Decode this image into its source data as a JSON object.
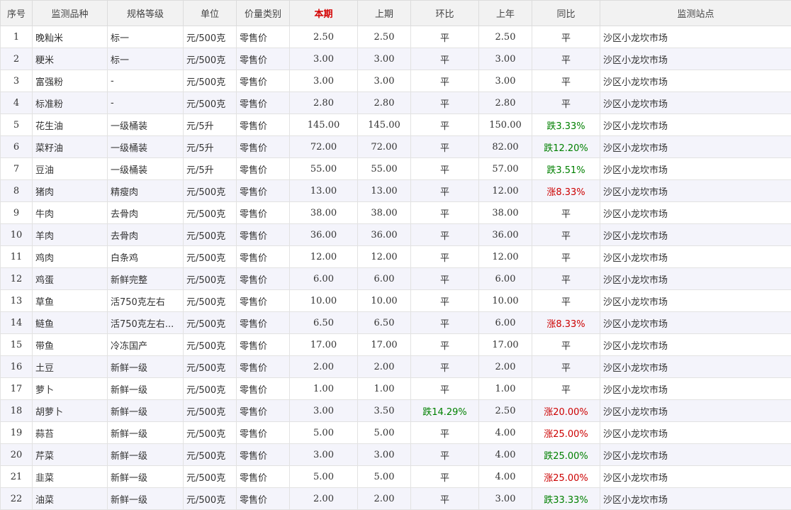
{
  "colors": {
    "current_header": "#d40000",
    "rise": "#cc0000",
    "fall": "#008000",
    "header_bg": "#f2f2f2",
    "stripe_bg": "#f4f4fb"
  },
  "headers": {
    "index": "序号",
    "name": "监测品种",
    "spec": "规格等级",
    "unit": "单位",
    "price_type": "价量类别",
    "current": "本期",
    "previous": "上期",
    "mom": "环比",
    "last_year": "上年",
    "yoy": "同比",
    "site": "监测站点"
  },
  "rows": [
    {
      "index": "1",
      "name": "晚籼米",
      "spec": "标一",
      "unit": "元/500克",
      "price_type": "零售价",
      "current": "2.50",
      "previous": "2.50",
      "mom": "平",
      "mom_dir": "flat",
      "last_year": "2.50",
      "yoy": "平",
      "yoy_dir": "flat",
      "site": "沙区小龙坎市场"
    },
    {
      "index": "2",
      "name": "粳米",
      "spec": "标一",
      "unit": "元/500克",
      "price_type": "零售价",
      "current": "3.00",
      "previous": "3.00",
      "mom": "平",
      "mom_dir": "flat",
      "last_year": "3.00",
      "yoy": "平",
      "yoy_dir": "flat",
      "site": "沙区小龙坎市场"
    },
    {
      "index": "3",
      "name": "富强粉",
      "spec": "-",
      "unit": "元/500克",
      "price_type": "零售价",
      "current": "3.00",
      "previous": "3.00",
      "mom": "平",
      "mom_dir": "flat",
      "last_year": "3.00",
      "yoy": "平",
      "yoy_dir": "flat",
      "site": "沙区小龙坎市场"
    },
    {
      "index": "4",
      "name": "标准粉",
      "spec": "-",
      "unit": "元/500克",
      "price_type": "零售价",
      "current": "2.80",
      "previous": "2.80",
      "mom": "平",
      "mom_dir": "flat",
      "last_year": "2.80",
      "yoy": "平",
      "yoy_dir": "flat",
      "site": "沙区小龙坎市场"
    },
    {
      "index": "5",
      "name": "花生油",
      "spec": "一级桶装",
      "unit": "元/5升",
      "price_type": "零售价",
      "current": "145.00",
      "previous": "145.00",
      "mom": "平",
      "mom_dir": "flat",
      "last_year": "150.00",
      "yoy": "跌3.33%",
      "yoy_dir": "down",
      "site": "沙区小龙坎市场"
    },
    {
      "index": "6",
      "name": "菜籽油",
      "spec": "一级桶装",
      "unit": "元/5升",
      "price_type": "零售价",
      "current": "72.00",
      "previous": "72.00",
      "mom": "平",
      "mom_dir": "flat",
      "last_year": "82.00",
      "yoy": "跌12.20%",
      "yoy_dir": "down",
      "site": "沙区小龙坎市场"
    },
    {
      "index": "7",
      "name": "豆油",
      "spec": "一级桶装",
      "unit": "元/5升",
      "price_type": "零售价",
      "current": "55.00",
      "previous": "55.00",
      "mom": "平",
      "mom_dir": "flat",
      "last_year": "57.00",
      "yoy": "跌3.51%",
      "yoy_dir": "down",
      "site": "沙区小龙坎市场"
    },
    {
      "index": "8",
      "name": "猪肉",
      "spec": "精瘦肉",
      "unit": "元/500克",
      "price_type": "零售价",
      "current": "13.00",
      "previous": "13.00",
      "mom": "平",
      "mom_dir": "flat",
      "last_year": "12.00",
      "yoy": "涨8.33%",
      "yoy_dir": "up",
      "site": "沙区小龙坎市场"
    },
    {
      "index": "9",
      "name": "牛肉",
      "spec": "去骨肉",
      "unit": "元/500克",
      "price_type": "零售价",
      "current": "38.00",
      "previous": "38.00",
      "mom": "平",
      "mom_dir": "flat",
      "last_year": "38.00",
      "yoy": "平",
      "yoy_dir": "flat",
      "site": "沙区小龙坎市场"
    },
    {
      "index": "10",
      "name": "羊肉",
      "spec": "去骨肉",
      "unit": "元/500克",
      "price_type": "零售价",
      "current": "36.00",
      "previous": "36.00",
      "mom": "平",
      "mom_dir": "flat",
      "last_year": "36.00",
      "yoy": "平",
      "yoy_dir": "flat",
      "site": "沙区小龙坎市场"
    },
    {
      "index": "11",
      "name": "鸡肉",
      "spec": "白条鸡",
      "unit": "元/500克",
      "price_type": "零售价",
      "current": "12.00",
      "previous": "12.00",
      "mom": "平",
      "mom_dir": "flat",
      "last_year": "12.00",
      "yoy": "平",
      "yoy_dir": "flat",
      "site": "沙区小龙坎市场"
    },
    {
      "index": "12",
      "name": "鸡蛋",
      "spec": "新鲜完整",
      "unit": "元/500克",
      "price_type": "零售价",
      "current": "6.00",
      "previous": "6.00",
      "mom": "平",
      "mom_dir": "flat",
      "last_year": "6.00",
      "yoy": "平",
      "yoy_dir": "flat",
      "site": "沙区小龙坎市场"
    },
    {
      "index": "13",
      "name": "草鱼",
      "spec": "活750克左右",
      "unit": "元/500克",
      "price_type": "零售价",
      "current": "10.00",
      "previous": "10.00",
      "mom": "平",
      "mom_dir": "flat",
      "last_year": "10.00",
      "yoy": "平",
      "yoy_dir": "flat",
      "site": "沙区小龙坎市场"
    },
    {
      "index": "14",
      "name": "鲢鱼",
      "spec": "活750克左右...",
      "unit": "元/500克",
      "price_type": "零售价",
      "current": "6.50",
      "previous": "6.50",
      "mom": "平",
      "mom_dir": "flat",
      "last_year": "6.00",
      "yoy": "涨8.33%",
      "yoy_dir": "up",
      "site": "沙区小龙坎市场"
    },
    {
      "index": "15",
      "name": "带鱼",
      "spec": "冷冻国产",
      "unit": "元/500克",
      "price_type": "零售价",
      "current": "17.00",
      "previous": "17.00",
      "mom": "平",
      "mom_dir": "flat",
      "last_year": "17.00",
      "yoy": "平",
      "yoy_dir": "flat",
      "site": "沙区小龙坎市场"
    },
    {
      "index": "16",
      "name": "土豆",
      "spec": "新鲜一级",
      "unit": "元/500克",
      "price_type": "零售价",
      "current": "2.00",
      "previous": "2.00",
      "mom": "平",
      "mom_dir": "flat",
      "last_year": "2.00",
      "yoy": "平",
      "yoy_dir": "flat",
      "site": "沙区小龙坎市场"
    },
    {
      "index": "17",
      "name": "萝卜",
      "spec": "新鲜一级",
      "unit": "元/500克",
      "price_type": "零售价",
      "current": "1.00",
      "previous": "1.00",
      "mom": "平",
      "mom_dir": "flat",
      "last_year": "1.00",
      "yoy": "平",
      "yoy_dir": "flat",
      "site": "沙区小龙坎市场"
    },
    {
      "index": "18",
      "name": "胡萝卜",
      "spec": "新鲜一级",
      "unit": "元/500克",
      "price_type": "零售价",
      "current": "3.00",
      "previous": "3.50",
      "mom": "跌14.29%",
      "mom_dir": "down",
      "last_year": "2.50",
      "yoy": "涨20.00%",
      "yoy_dir": "up",
      "site": "沙区小龙坎市场"
    },
    {
      "index": "19",
      "name": "蒜苔",
      "spec": "新鲜一级",
      "unit": "元/500克",
      "price_type": "零售价",
      "current": "5.00",
      "previous": "5.00",
      "mom": "平",
      "mom_dir": "flat",
      "last_year": "4.00",
      "yoy": "涨25.00%",
      "yoy_dir": "up",
      "site": "沙区小龙坎市场"
    },
    {
      "index": "20",
      "name": "芹菜",
      "spec": "新鲜一级",
      "unit": "元/500克",
      "price_type": "零售价",
      "current": "3.00",
      "previous": "3.00",
      "mom": "平",
      "mom_dir": "flat",
      "last_year": "4.00",
      "yoy": "跌25.00%",
      "yoy_dir": "down",
      "site": "沙区小龙坎市场"
    },
    {
      "index": "21",
      "name": "韭菜",
      "spec": "新鲜一级",
      "unit": "元/500克",
      "price_type": "零售价",
      "current": "5.00",
      "previous": "5.00",
      "mom": "平",
      "mom_dir": "flat",
      "last_year": "4.00",
      "yoy": "涨25.00%",
      "yoy_dir": "up",
      "site": "沙区小龙坎市场"
    },
    {
      "index": "22",
      "name": "油菜",
      "spec": "新鲜一级",
      "unit": "元/500克",
      "price_type": "零售价",
      "current": "2.00",
      "previous": "2.00",
      "mom": "平",
      "mom_dir": "flat",
      "last_year": "3.00",
      "yoy": "跌33.33%",
      "yoy_dir": "down",
      "site": "沙区小龙坎市场"
    }
  ]
}
